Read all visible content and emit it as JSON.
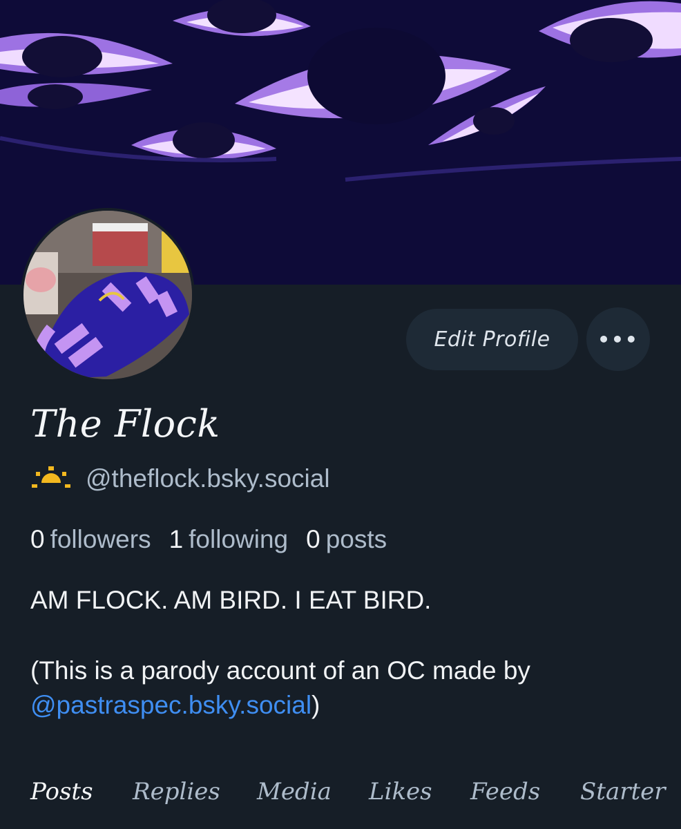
{
  "profile": {
    "display_name": "The Flock",
    "handle": "@theflock.bsky.social",
    "handle_icon": "sun-icon",
    "stats": {
      "followers_count": "0",
      "followers_label": "followers",
      "following_count": "1",
      "following_label": "following",
      "posts_count": "0",
      "posts_label": "posts"
    },
    "bio": {
      "line1": "AM FLOCK. AM BIRD. I EAT BIRD.",
      "line2": "(This is a parody account of an OC made by",
      "mention": "@pastraspec.bsky.social",
      "line3_suffix": ")"
    }
  },
  "actions": {
    "edit_profile_label": "Edit Profile",
    "more_label": "•••"
  },
  "tabs": [
    "Posts",
    "Replies",
    "Media",
    "Likes",
    "Feeds",
    "Starter"
  ],
  "colors": {
    "background": "#161e27",
    "banner": "#0e0b38",
    "accent_link": "#3f8ef2",
    "muted_text": "#aebccb",
    "icon_yellow": "#f3b81f"
  }
}
